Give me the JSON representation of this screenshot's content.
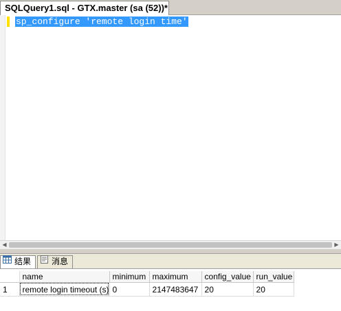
{
  "document_tab": {
    "title": "SQLQuery1.sql - GTX.master (sa (52))*"
  },
  "editor": {
    "lines": [
      "sp_configure 'remote login time'"
    ]
  },
  "results_tabs": {
    "results_label": "结果",
    "messages_label": "消息"
  },
  "grid": {
    "columns": [
      "name",
      "minimum",
      "maximum",
      "config_value",
      "run_value"
    ],
    "rows": [
      {
        "row_number": "1",
        "name": "remote login timeout (s)",
        "minimum": "0",
        "maximum": "2147483647",
        "config_value": "20",
        "run_value": "20"
      }
    ]
  },
  "colors": {
    "selection": "#3399ff",
    "change_marker": "#ffe000",
    "chrome": "#d4d0c8"
  }
}
